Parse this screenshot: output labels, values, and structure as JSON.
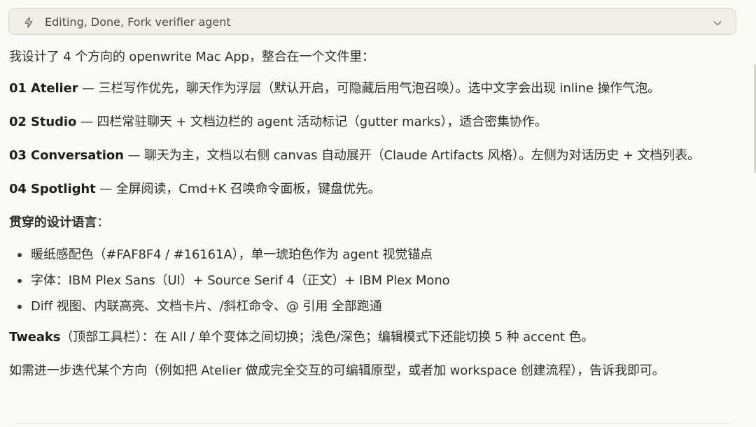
{
  "header": {
    "summary": "Editing, Done, Fork verifier agent",
    "icon": "bolt-icon",
    "toggle_icon": "chevron-down-icon"
  },
  "message": {
    "intro": "我设计了 4 个方向的 openwrite Mac App，整合在一个文件里：",
    "options": [
      {
        "title": "01 Atelier",
        "text": " — 三栏写作优先，聊天作为浮层（默认开启，可隐藏后用气泡召唤）。选中文字会出现 inline 操作气泡。"
      },
      {
        "title": "02 Studio",
        "text": " — 四栏常驻聊天 + 文档边栏的 agent 活动标记（gutter marks），适合密集协作。"
      },
      {
        "title": "03 Conversation",
        "text": " — 聊天为主，文档以右侧 canvas 自动展开（Claude Artifacts 风格）。左侧为对话历史 + 文档列表。"
      },
      {
        "title": "04 Spotlight",
        "text": " — 全屏阅读，Cmd+K 召唤命令面板，键盘优先。"
      }
    ],
    "design_heading": "贯穿的设计语言",
    "design_colon": "：",
    "design_points": [
      "暖纸感配色（#FAF8F4 / #16161A），单一琥珀色作为 agent 视觉锚点",
      "字体：IBM Plex Sans（UI）+ Source Serif 4（正文）+ IBM Plex Mono",
      "Diff 视图、内联高亮、文档卡片、/斜杠命令、@ 引用 全部跑通"
    ],
    "tweaks_title": "Tweaks",
    "tweaks_text": "（顶部工具栏）：在 All / 单个变体之间切换；浅色/深色；编辑模式下还能切换 5 种 accent 色。",
    "closing": "如需进一步迭代某个方向（例如把 Atelier 做成完全交互的可编辑原型，或者加 workspace 创建流程），告诉我即可。"
  },
  "colors": {
    "background": "#FAFAF7",
    "header_background": "#F1EFE8",
    "header_border": "#D8D5CC",
    "text": "#2F2E2A"
  }
}
